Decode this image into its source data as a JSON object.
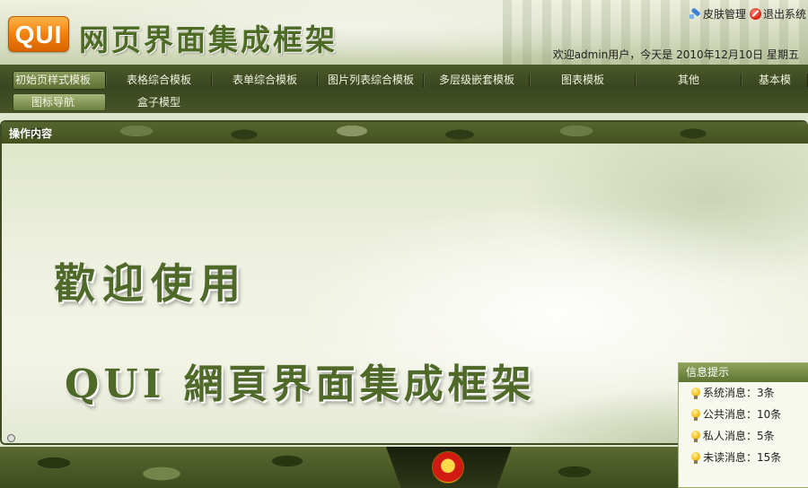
{
  "header": {
    "logo_text": "QUI",
    "title": "网页界面集成框架",
    "skin_link": "皮肤管理",
    "exit_link": "退出系统",
    "welcome": "欢迎admin用户，今天是 2010年12月10日 星期五"
  },
  "nav": {
    "items": [
      "初始页样式模板",
      "表格综合模板",
      "表单综合模板",
      "图片列表综合模板",
      "多层级嵌套模板",
      "图表模板",
      "其他",
      "基本模"
    ],
    "active_index": 0,
    "sub_items": [
      "图标导航",
      "盒子模型"
    ],
    "sub_active_index": 0
  },
  "panel": {
    "title": "操作内容",
    "welcome_line1": "歡迎使用",
    "welcome_line2": "QUI 網頁界面集成框架"
  },
  "info_box": {
    "title": "信息提示",
    "items": [
      "系统消息：3条",
      "公共消息：10条",
      "私人消息：5条",
      "未读消息：15条"
    ]
  },
  "colors": {
    "nav_bg": "#3a4620",
    "title_green": "#4e6b26",
    "logo_orange": "#f07d0a",
    "panel_bg": "#eef0e0"
  },
  "icons": {
    "skin": "skin-brush-icon",
    "exit": "exit-icon",
    "bullet": "lightbulb-icon",
    "footer": "national-emblem-icon"
  }
}
